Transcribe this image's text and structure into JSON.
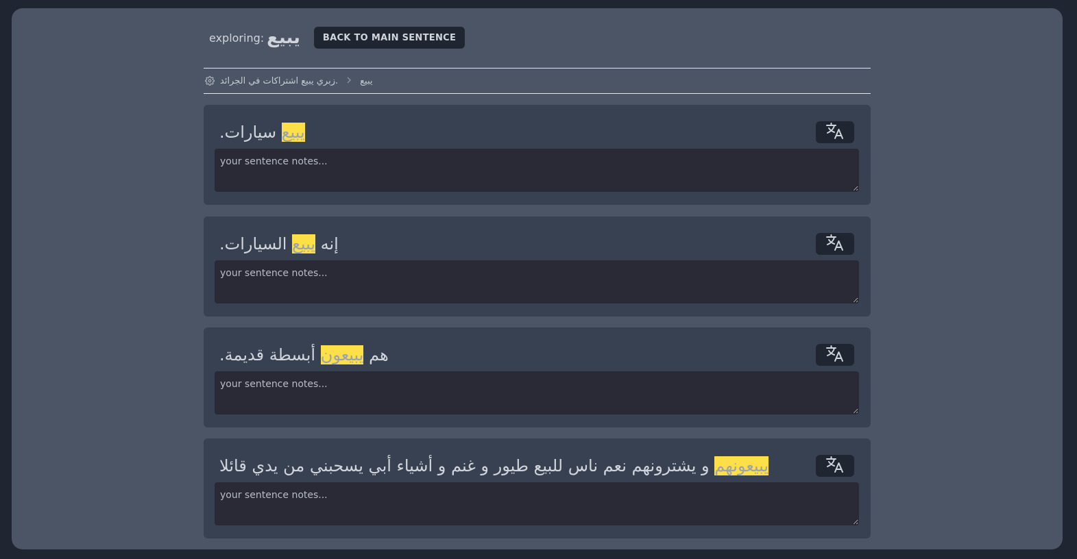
{
  "header": {
    "exploring_label": "exploring:",
    "word": "يبيع",
    "back_button": "BACK TO MAIN SENTENCE"
  },
  "breadcrumb": {
    "icon": "gear-icon",
    "main_sentence": "زبري يبيع اشتراكات في الجرائد.",
    "current": "يبيع"
  },
  "notes_placeholder": "your sentence notes...",
  "cards": [
    {
      "highlight": "يبيع",
      "rest": " سيارات."
    },
    {
      "highlight": "يبيع",
      "rest": " السيارات.",
      "prefix": "إنه "
    },
    {
      "highlight": "يبيعون",
      "rest": " أبسطة قديمة.",
      "prefix": "هم "
    },
    {
      "highlight": "يبيعونهم",
      "rest": " و يشترونهم  نعم  ناس للبيع  طيور  و غنم  و أشياء  أبي يسحبني من يدي قائلا"
    }
  ],
  "colors": {
    "page_bg": "#1f2631",
    "window_bg": "#4b5565",
    "card_bg": "#374151",
    "notes_bg": "#2a2a36",
    "highlight": "#fde047"
  }
}
